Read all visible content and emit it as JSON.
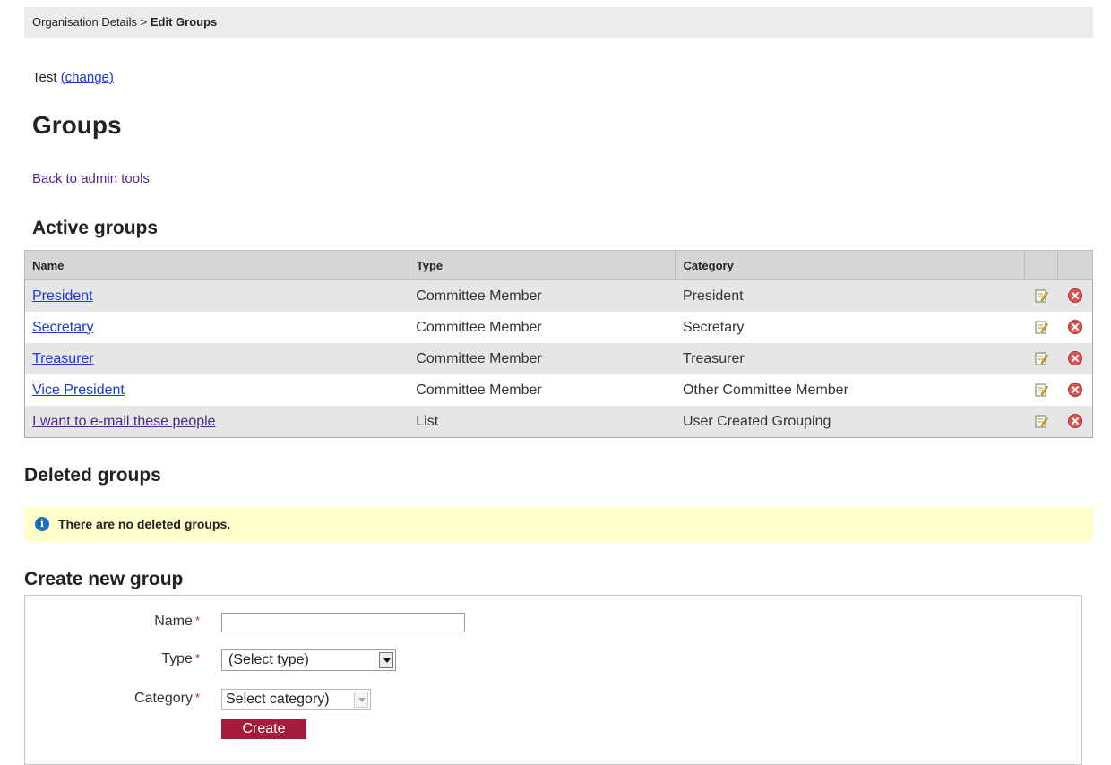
{
  "breadcrumb": {
    "parent": "Organisation Details",
    "separator": " > ",
    "current": "Edit Groups"
  },
  "organisation": {
    "name": "Test",
    "change_link": "(change)"
  },
  "page": {
    "title": "Groups",
    "back_link": "Back to admin tools"
  },
  "active_groups": {
    "heading": "Active groups",
    "columns": [
      "Name",
      "Type",
      "Category",
      "",
      ""
    ],
    "rows": [
      {
        "name": "President",
        "type": "Committee Member",
        "category": "President"
      },
      {
        "name": "Secretary",
        "type": "Committee Member",
        "category": "Secretary"
      },
      {
        "name": "Treasurer",
        "type": "Committee Member",
        "category": "Treasurer"
      },
      {
        "name": "Vice President",
        "type": "Committee Member",
        "category": "Other Committee Member"
      },
      {
        "name": "I want to e-mail these people",
        "type": "List",
        "category": "User Created Grouping"
      }
    ]
  },
  "deleted_groups": {
    "heading": "Deleted groups",
    "notice": "There are no deleted groups.",
    "notice_icon": "info-icon"
  },
  "create_group": {
    "heading": "Create new group",
    "name_label": "Name",
    "name_value": "",
    "type_label": "Type",
    "type_selected": "(Select type)",
    "category_label": "Category",
    "category_selected": "Select category)",
    "required_marker": "*",
    "submit_label": "Create"
  },
  "colors": {
    "link": "#1a3bd4",
    "visited_link": "#4b2a87",
    "button": "#a51c3a",
    "notice_bg": "#ffffcc",
    "info_icon": "#1b70c0",
    "delete_icon": "#d9534f"
  }
}
